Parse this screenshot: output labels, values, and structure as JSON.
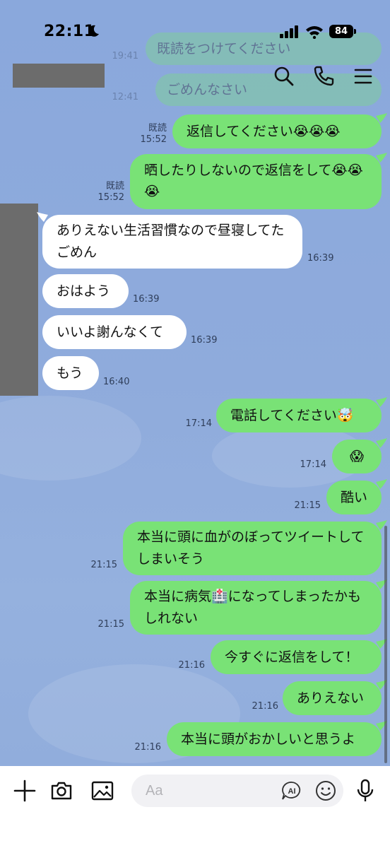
{
  "status_bar": {
    "time": "22:11",
    "battery": "84"
  },
  "faded_top": {
    "msg1_time": "19:41",
    "msg1_text": "既読をつけてください",
    "msg2_time": "12:41",
    "msg2_text": "ごめんなさい"
  },
  "messages": [
    {
      "side": "out",
      "read": "既読",
      "time": "15:52",
      "text": "返信してください😭😭😭"
    },
    {
      "side": "out",
      "read": "既読",
      "time": "15:52",
      "text": "晒したりしないので返信をして😭😭😭"
    },
    {
      "side": "in",
      "time": "16:39",
      "text": "ありえない生活習慣なので昼寝してたごめん"
    },
    {
      "side": "in",
      "time": "16:39",
      "text": "おはよう"
    },
    {
      "side": "in",
      "time": "16:39",
      "text": "いいよ謝んなくて"
    },
    {
      "side": "in",
      "time": "16:40",
      "text": "もう"
    },
    {
      "side": "out",
      "time": "17:14",
      "text": "電話してください🤯"
    },
    {
      "side": "out",
      "time": "17:14",
      "text": "😱"
    },
    {
      "side": "out",
      "time": "21:15",
      "text": "酷い"
    },
    {
      "side": "out",
      "time": "21:15",
      "text": "本当に頭に血がのぼってツイートしてしまいそう"
    },
    {
      "side": "out",
      "time": "21:15",
      "text": "本当に病気🏥になってしまったかもしれない"
    },
    {
      "side": "out",
      "time": "21:16",
      "text": "今すぐに返信をして！"
    },
    {
      "side": "out",
      "time": "21:16",
      "text": "ありえない"
    },
    {
      "side": "out",
      "time": "21:16",
      "text": "本当に頭がおかしいと思うよ"
    }
  ],
  "input": {
    "placeholder": "Aa",
    "ai_label": "AI"
  },
  "icons": {
    "header": [
      "search-icon",
      "phone-icon",
      "menu-icon"
    ],
    "input_bar": [
      "plus-icon",
      "camera-icon",
      "image-icon",
      "ai-icon",
      "emoji-icon",
      "mic-icon"
    ]
  },
  "colors": {
    "outgoing_bubble": "#79e276",
    "incoming_bubble": "#ffffff",
    "background": "#8fabdc"
  }
}
